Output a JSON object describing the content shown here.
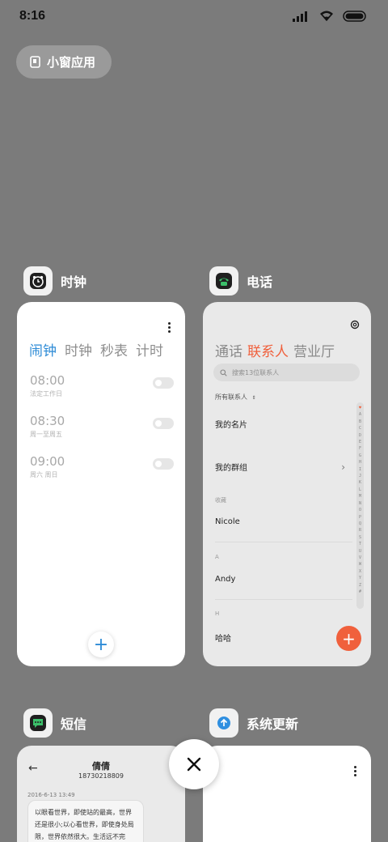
{
  "status_bar": {
    "time": "8:16",
    "icons": [
      "signal-icon",
      "wifi-icon",
      "battery-icon"
    ]
  },
  "small_window_button": {
    "label": "小窗应用",
    "icon": "small-window-icon"
  },
  "apps": {
    "clock": {
      "name": "时钟",
      "icon": "alarm-clock-icon",
      "tabs": [
        "闹钟",
        "时钟",
        "秒表",
        "计时"
      ],
      "active_tab": "闹钟",
      "alarms": [
        {
          "time": "08:00",
          "repeat": "法定工作日",
          "enabled": false
        },
        {
          "time": "08:30",
          "repeat": "周一至周五",
          "enabled": false
        },
        {
          "time": "09:00",
          "repeat": "周六 周日",
          "enabled": false
        }
      ],
      "add_label": "+"
    },
    "phone": {
      "name": "电话",
      "icon": "telephone-icon",
      "tabs": [
        "通话",
        "联系人",
        "营业厅"
      ],
      "active_tab": "联系人",
      "search_placeholder": "搜索13位联系人",
      "all_contacts_label": "所有联系人",
      "my_card": "我的名片",
      "my_groups": "我的群组",
      "sections": [
        {
          "header": "收藏",
          "contact": "Nicole"
        },
        {
          "header": "A",
          "contact": "Andy"
        },
        {
          "header": "H",
          "contact": "哈哈"
        }
      ],
      "index_letters": [
        "♥",
        "A",
        "B",
        "C",
        "D",
        "E",
        "F",
        "G",
        "H",
        "I",
        "J",
        "K",
        "L",
        "M",
        "N",
        "O",
        "P",
        "Q",
        "R",
        "S",
        "T",
        "U",
        "V",
        "W",
        "X",
        "Y",
        "Z",
        "#"
      ],
      "add_label": "+"
    },
    "sms": {
      "name": "短信",
      "icon": "chat-bubble-icon",
      "contact_name": "倩倩",
      "contact_number": "18730218809",
      "date": "2016-6-13 13:49",
      "message": "以眼看世界，即使站的最高，世界还是很小;以心看世界，即使身处局限，世界依然很大。生活远不完美，需要不断去追求"
    },
    "update": {
      "name": "系统更新",
      "icon": "arrow-up-icon"
    }
  },
  "colors": {
    "background": "#7b7b7b",
    "clock_accent": "#2d8bd6",
    "phone_accent": "#f0603c"
  }
}
